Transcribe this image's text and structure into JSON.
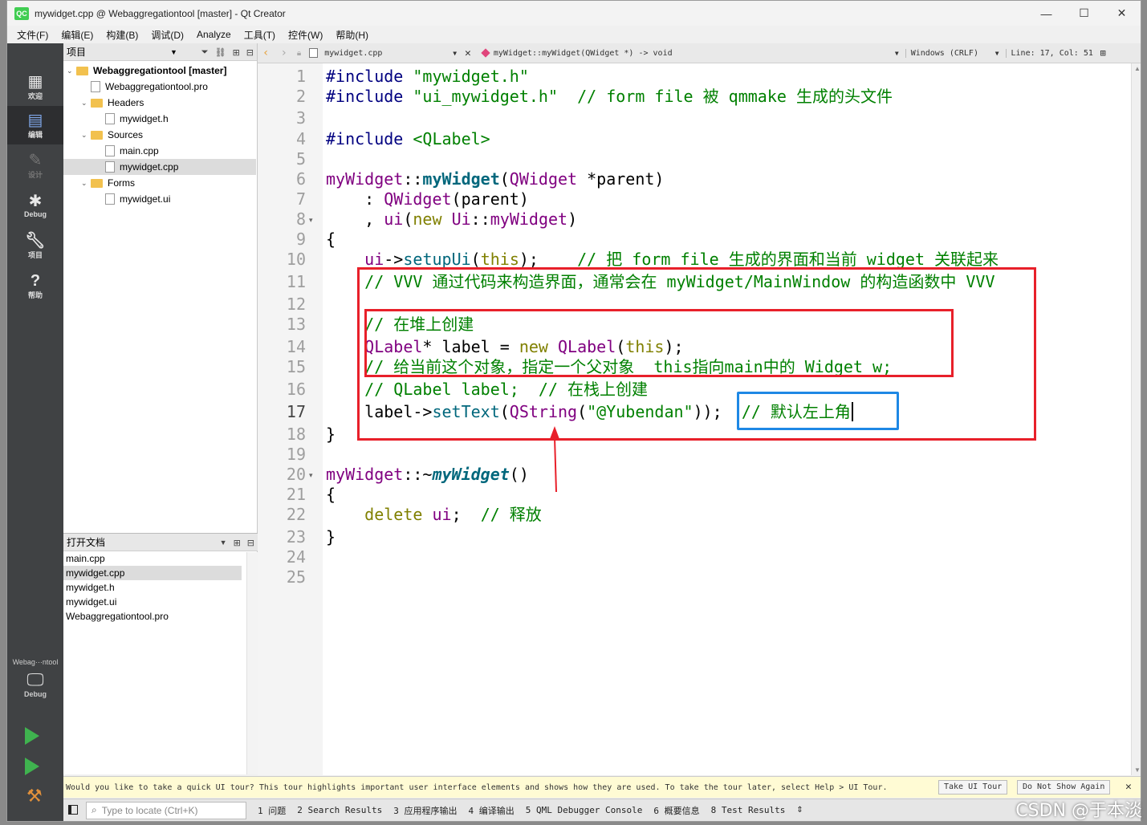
{
  "window": {
    "title": "mywidget.cpp @ Webaggregationtool [master] - Qt Creator",
    "app_badge": "QC",
    "controls": [
      "—",
      "☐",
      "✕"
    ]
  },
  "menu": [
    "文件(F)",
    "编辑(E)",
    "构建(B)",
    "调试(D)",
    "Analyze",
    "工具(T)",
    "控件(W)",
    "帮助(H)"
  ],
  "modes": [
    {
      "label": "欢迎",
      "icon": "grid-icon"
    },
    {
      "label": "编辑",
      "icon": "edit-icon"
    },
    {
      "label": "设计",
      "icon": "pencil-icon"
    },
    {
      "label": "Debug",
      "icon": "bug-icon"
    },
    {
      "label": "项目",
      "icon": "wrench-icon"
    },
    {
      "label": "帮助",
      "icon": "help-icon"
    }
  ],
  "kit": {
    "name": "Webag···ntool",
    "mode": "Debug"
  },
  "project_pane": {
    "title": "项目",
    "tree": [
      {
        "label": "Webaggregationtool [master]",
        "level": 0,
        "kind": "project",
        "expanded": true
      },
      {
        "label": "Webaggregationtool.pro",
        "level": 1,
        "kind": "pro"
      },
      {
        "label": "Headers",
        "level": 1,
        "kind": "folder",
        "expanded": true
      },
      {
        "label": "mywidget.h",
        "level": 2,
        "kind": "h"
      },
      {
        "label": "Sources",
        "level": 1,
        "kind": "folder",
        "expanded": true
      },
      {
        "label": "main.cpp",
        "level": 2,
        "kind": "cpp"
      },
      {
        "label": "mywidget.cpp",
        "level": 2,
        "kind": "cpp",
        "selected": true
      },
      {
        "label": "Forms",
        "level": 1,
        "kind": "folder",
        "expanded": true
      },
      {
        "label": "mywidget.ui",
        "level": 2,
        "kind": "ui"
      }
    ]
  },
  "open_docs": {
    "title": "打开文档",
    "items": [
      "main.cpp",
      "mywidget.cpp",
      "mywidget.h",
      "mywidget.ui",
      "Webaggregationtool.pro"
    ],
    "selected": 1
  },
  "editor_bar": {
    "file": "mywidget.cpp",
    "symbol": "myWidget::myWidget(QWidget *) -> void",
    "line_ending": "Windows (CRLF)",
    "position": "Line: 17, Col: 51"
  },
  "code": {
    "current_line": 17,
    "lines": [
      [
        [
          "mac",
          "#include "
        ],
        [
          "st",
          "\"mywidget.h\""
        ]
      ],
      [
        [
          "mac",
          "#include "
        ],
        [
          "st",
          "\"ui_mywidget.h\""
        ],
        [
          "pun",
          "  "
        ],
        [
          "cm",
          "// form file 被 qmmake 生成的头文件"
        ]
      ],
      [],
      [
        [
          "mac",
          "#include "
        ],
        [
          "st",
          "<QLabel>"
        ]
      ],
      [],
      [
        [
          "ty",
          "myWidget"
        ],
        [
          "pun",
          "::"
        ],
        [
          "fnb",
          "myWidget"
        ],
        [
          "pun",
          "("
        ],
        [
          "ty",
          "QWidget"
        ],
        [
          "pun",
          " *parent)"
        ]
      ],
      [
        [
          "pun",
          "    : "
        ],
        [
          "ty",
          "QWidget"
        ],
        [
          "pun",
          "(parent)"
        ]
      ],
      [
        [
          "pun",
          "    , "
        ],
        [
          "ty",
          "ui"
        ],
        [
          "pun",
          "("
        ],
        [
          "kw",
          "new "
        ],
        [
          "ty",
          "Ui"
        ],
        [
          "pun",
          "::"
        ],
        [
          "ty",
          "myWidget"
        ],
        [
          "pun",
          ")"
        ]
      ],
      [
        [
          "pun",
          "{"
        ]
      ],
      [
        [
          "pun",
          "    "
        ],
        [
          "ty",
          "ui"
        ],
        [
          "pun",
          "->"
        ],
        [
          "fn",
          "setupUi"
        ],
        [
          "pun",
          "("
        ],
        [
          "kw",
          "this"
        ],
        [
          "pun",
          ");    "
        ],
        [
          "cm",
          "// 把 form file 生成的界面和当前 widget 关联起来"
        ]
      ],
      [
        [
          "pun",
          "    "
        ],
        [
          "cm",
          "// VVV 通过代码来构造界面，通常会在 myWidget/MainWindow 的构造函数中 VVV"
        ]
      ],
      [],
      [
        [
          "pun",
          "    "
        ],
        [
          "cm",
          "// 在堆上创建"
        ]
      ],
      [
        [
          "pun",
          "    "
        ],
        [
          "ty",
          "QLabel"
        ],
        [
          "pun",
          "* label = "
        ],
        [
          "kw",
          "new "
        ],
        [
          "ty",
          "QLabel"
        ],
        [
          "pun",
          "("
        ],
        [
          "kw",
          "this"
        ],
        [
          "pun",
          ");"
        ]
      ],
      [
        [
          "pun",
          "    "
        ],
        [
          "cm",
          "// 给当前这个对象，指定一个父对象  this指向main中的 Widget w;"
        ]
      ],
      [
        [
          "pun",
          "    "
        ],
        [
          "cm",
          "// QLabel label;  // 在栈上创建"
        ]
      ],
      [
        [
          "pun",
          "    label->"
        ],
        [
          "fn",
          "setText"
        ],
        [
          "pun",
          "("
        ],
        [
          "ty",
          "QString"
        ],
        [
          "pun",
          "("
        ],
        [
          "st",
          "\"@Yubendan\""
        ],
        [
          "pun",
          "));  "
        ],
        [
          "cm",
          "// 默认左上角"
        ]
      ],
      [
        [
          "pun",
          "}"
        ]
      ],
      [],
      [
        [
          "ty",
          "myWidget"
        ],
        [
          "pun",
          "::~"
        ],
        [
          "fni",
          "myWidget"
        ],
        [
          "pun",
          "()"
        ]
      ],
      [
        [
          "pun",
          "{"
        ]
      ],
      [
        [
          "pun",
          "    "
        ],
        [
          "kw",
          "delete "
        ],
        [
          "ty",
          "ui"
        ],
        [
          "pun",
          ";  "
        ],
        [
          "cm",
          "// 释放"
        ]
      ],
      [
        [
          "pun",
          "}"
        ]
      ],
      [],
      []
    ],
    "fold_markers": [
      8,
      20
    ]
  },
  "tour": {
    "message": "Would you like to take a quick UI tour? This tour highlights important user interface elements and shows how they are used. To take the tour later, select Help > UI Tour.",
    "take_label": "Take UI Tour",
    "dismiss_label": "Do Not Show Again",
    "close": "✕"
  },
  "statusbar": {
    "locator_placeholder": "Type to locate (Ctrl+K)",
    "panes": [
      "1 问题",
      "2 Search Results",
      "3 应用程序输出",
      "4 编译输出",
      "5 QML Debugger Console",
      "6 概要信息",
      "8 Test Results"
    ]
  },
  "watermark": "CSDN @于本淡",
  "colors": {
    "annotation_red": "#e8202a",
    "annotation_blue": "#1e88e5",
    "modebar": "#404244"
  }
}
